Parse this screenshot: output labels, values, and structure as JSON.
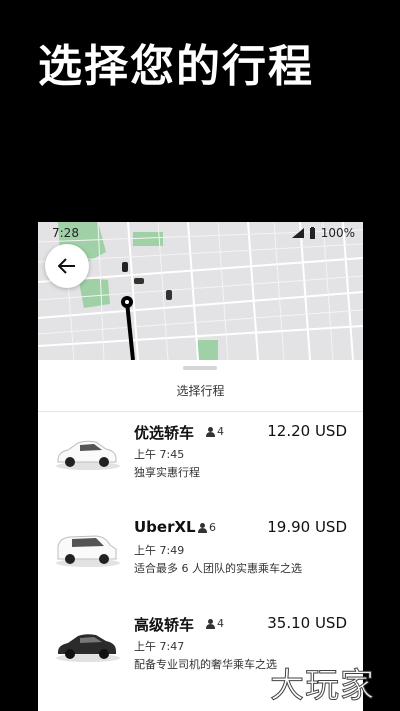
{
  "promo": {
    "title": "选择您的行程"
  },
  "status_bar": {
    "time": "7:28",
    "battery": "100%"
  },
  "sheet": {
    "title": "选择行程"
  },
  "rides": [
    {
      "name": "优选轿车",
      "seats": "4",
      "price": "12.20 USD",
      "time": "上午 7:45",
      "description": "独享实惠行程",
      "car_color": "#ffffff"
    },
    {
      "name": "UberXL",
      "seats": "6",
      "price": "19.90 USD",
      "time": "上午 7:49",
      "description": "适合最多 6 人团队的实惠乘车之选",
      "car_color": "#ffffff"
    },
    {
      "name": "高级轿车",
      "seats": "4",
      "price": "35.10 USD",
      "time": "上午 7:47",
      "description": "配备专业司机的奢华乘车之选",
      "car_color": "#2b2b2b"
    }
  ],
  "watermark": {
    "text": "大玩家"
  },
  "icons": {
    "back": "arrow-left-icon",
    "person": "person-icon",
    "signal": "signal-icon",
    "battery": "battery-icon"
  }
}
